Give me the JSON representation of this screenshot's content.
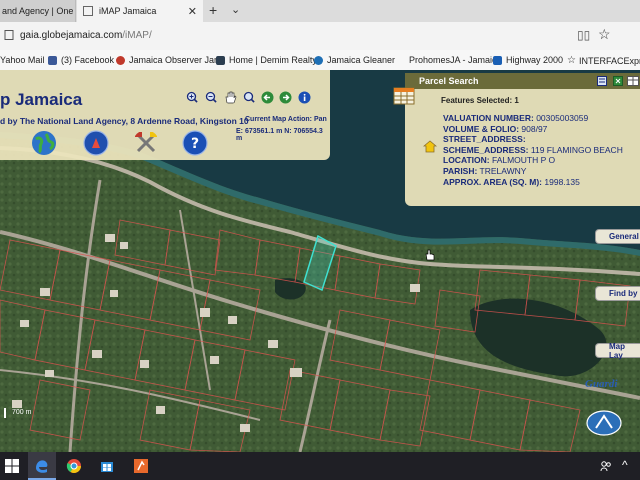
{
  "browser": {
    "tabs": [
      {
        "label": "and Agency | One"
      },
      {
        "label": "iMAP Jamaica"
      }
    ],
    "new_tab": "+",
    "tab_menu": "⌄",
    "close": "✕",
    "url_host": "gaia.globejamaica.com",
    "url_path": "/iMAP/"
  },
  "favorites": [
    {
      "label": "Yahoo Mail",
      "color": "#6a1fb0"
    },
    {
      "label": "(3) Facebook",
      "color": "#3b5998"
    },
    {
      "label": "Jamaica Observer Jan",
      "color": "#c0392b"
    },
    {
      "label": "Home | Demim Realty",
      "color": "#2c3e50"
    },
    {
      "label": "Jamaica Gleaner",
      "color": "#1e6fb5"
    },
    {
      "label": "ProhomesJA - Jamaic",
      "color": "#ffffff"
    },
    {
      "label": "Highway 2000",
      "color": "#1a5fb4"
    },
    {
      "label": "INTERFACExpres",
      "color": "#444444"
    }
  ],
  "app": {
    "title": "p Jamaica",
    "credit": "d by The National Land Agency, 8 Ardenne Road, Kingston 10",
    "map_action_label": "Current Map Action: Pan",
    "coords": "E: 673561.1 m   N: 706554.3 m",
    "scale_label": "700 m"
  },
  "parcel": {
    "title": "Parcel Search",
    "features_selected": "Features Selected: 1",
    "fields": [
      {
        "key": "VALUATION NUMBER:",
        "value": "00305003059"
      },
      {
        "key": "VOLUME & FOLIO:",
        "value": "908/97"
      },
      {
        "key": "STREET_ADDRESS:",
        "value": ""
      },
      {
        "key": "SCHEME_ADDRESS:",
        "value": "119 FLAMINGO BEACH"
      },
      {
        "key": "LOCATION:",
        "value": "FALMOUTH P O"
      },
      {
        "key": "PARISH:",
        "value": "TRELAWNY"
      },
      {
        "key": "APPROX. AREA (SQ. M):",
        "value": "1998.135"
      }
    ]
  },
  "side_buttons": [
    "General",
    "Find by",
    "Map Lay"
  ],
  "colors": {
    "accent": "#1a2b7a",
    "panel": "#ece4bc",
    "parcel_highlight": "#3fe0d0",
    "parcel_lines": "#d9534f"
  }
}
